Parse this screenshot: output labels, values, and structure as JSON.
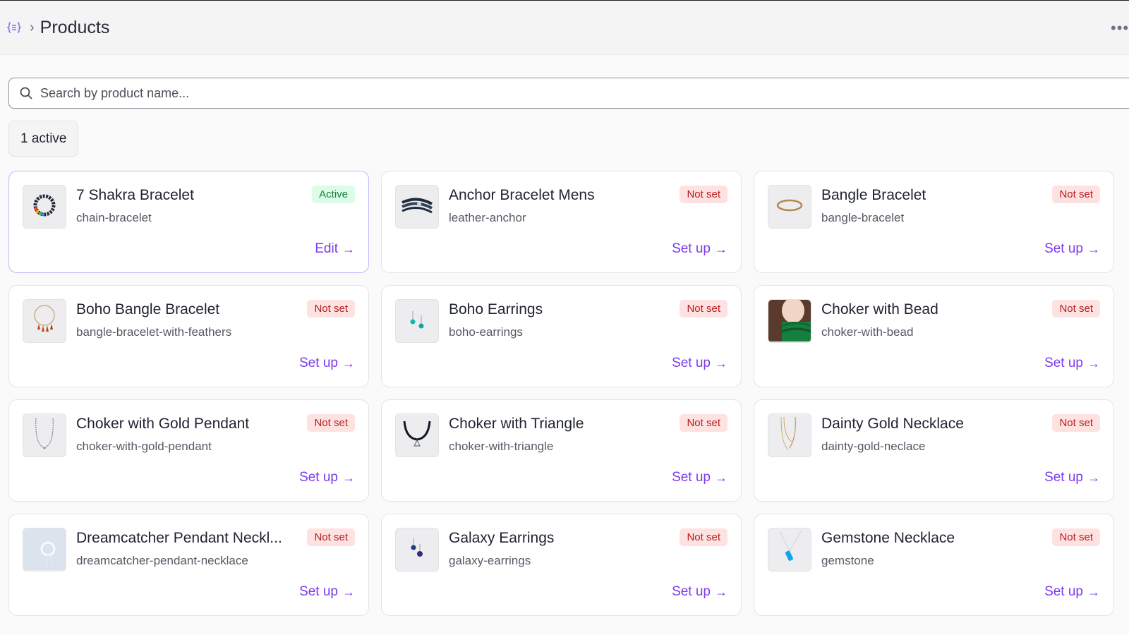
{
  "header": {
    "title": "Products",
    "app_icon": "braces-list-icon",
    "more_icon": "more-horizontal-icon"
  },
  "search": {
    "placeholder": "Search by product name...",
    "value": ""
  },
  "filter": {
    "label": "1 active"
  },
  "colors": {
    "accent": "#7c3aed",
    "active_bg": "#dcfce7",
    "active_fg": "#15803d",
    "notset_bg": "#fee2e2",
    "notset_fg": "#b91c1c"
  },
  "products": [
    {
      "name": "7 Shakra Bracelet",
      "slug": "chain-bracelet",
      "status": "Active",
      "action": "Edit",
      "thumb": "beaded-bracelet"
    },
    {
      "name": "Anchor Bracelet Mens",
      "slug": "leather-anchor",
      "status": "Not set",
      "action": "Set up",
      "thumb": "leather-bracelet"
    },
    {
      "name": "Bangle Bracelet",
      "slug": "bangle-bracelet",
      "status": "Not set",
      "action": "Set up",
      "thumb": "gold-bangle"
    },
    {
      "name": "Boho Bangle Bracelet",
      "slug": "bangle-bracelet-with-feathers",
      "status": "Not set",
      "action": "Set up",
      "thumb": "feather-bangle"
    },
    {
      "name": "Boho Earrings",
      "slug": "boho-earrings",
      "status": "Not set",
      "action": "Set up",
      "thumb": "turquoise-earrings"
    },
    {
      "name": "Choker with Bead",
      "slug": "choker-with-bead",
      "status": "Not set",
      "action": "Set up",
      "thumb": "green-scarf-photo"
    },
    {
      "name": "Choker with Gold Pendant",
      "slug": "choker-with-gold-pendant",
      "status": "Not set",
      "action": "Set up",
      "thumb": "thin-necklace"
    },
    {
      "name": "Choker with Triangle",
      "slug": "choker-with-triangle",
      "status": "Not set",
      "action": "Set up",
      "thumb": "black-choker"
    },
    {
      "name": "Dainty Gold Necklace",
      "slug": "dainty-gold-neclace",
      "status": "Not set",
      "action": "Set up",
      "thumb": "gold-chains"
    },
    {
      "name": "Dreamcatcher Pendant Neckl...",
      "slug": "dreamcatcher-pendant-necklace",
      "status": "Not set",
      "action": "Set up",
      "thumb": "dreamcatcher-pendant"
    },
    {
      "name": "Galaxy Earrings",
      "slug": "galaxy-earrings",
      "status": "Not set",
      "action": "Set up",
      "thumb": "blue-earrings"
    },
    {
      "name": "Gemstone Necklace",
      "slug": "gemstone",
      "status": "Not set",
      "action": "Set up",
      "thumb": "gemstone-pendant"
    }
  ]
}
